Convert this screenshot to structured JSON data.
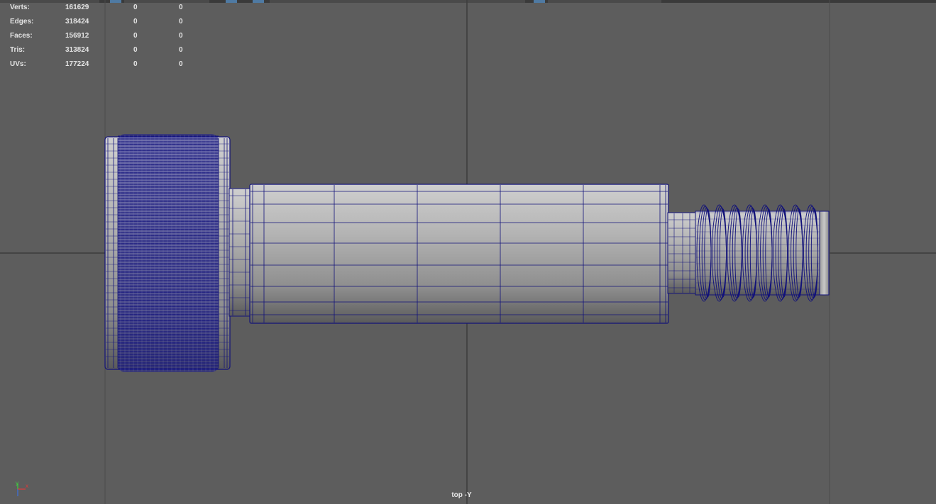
{
  "viewport": {
    "view_label": "top -Y",
    "background_color": "#5d5d5d",
    "wireframe_color": "#12127a",
    "mesh_color": "#a9a9a9"
  },
  "hud": {
    "rows": [
      {
        "label": "Verts:",
        "value": "161629",
        "selected": "0",
        "component": "0"
      },
      {
        "label": "Edges:",
        "value": "318424",
        "selected": "0",
        "component": "0"
      },
      {
        "label": "Faces:",
        "value": "156912",
        "selected": "0",
        "component": "0"
      },
      {
        "label": "Tris:",
        "value": "313824",
        "selected": "0",
        "component": "0"
      },
      {
        "label": "UVs:",
        "value": "177224",
        "selected": "0",
        "component": "0"
      }
    ]
  },
  "axis_gizmo": {
    "y_label": "y",
    "x_label": "x",
    "y_color": "#3fd13f",
    "x_color": "#e03a3a",
    "z_color": "#3a6fe0"
  }
}
